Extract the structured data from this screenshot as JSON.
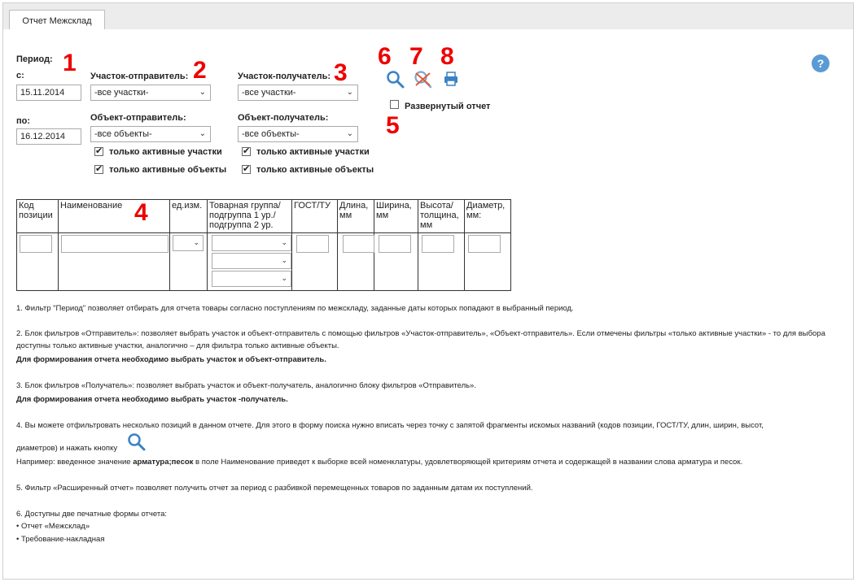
{
  "tab": "Отчет Межсклад",
  "period": {
    "label": "Период:",
    "from_label": "с:",
    "from_value": "15.11.2014",
    "to_label": "по:",
    "to_value": "16.12.2014"
  },
  "sender": {
    "section_label": "Участок-отправитель:",
    "section_value": "-все участки-",
    "object_label": "Объект-отправитель:",
    "object_value": "-все объекты-",
    "active_sections": "только активные участки",
    "active_objects": "только активные объекты"
  },
  "receiver": {
    "section_label": "Участок-получатель:",
    "section_value": "-все участки-",
    "object_label": "Объект-получатель:",
    "object_value": "-все объекты-",
    "active_sections": "только активные участки",
    "active_objects": "только активные объекты"
  },
  "expanded_report": "Развернутый отчет",
  "help": "?",
  "markers": [
    "1",
    "2",
    "3",
    "4",
    "5",
    "6",
    "7",
    "8"
  ],
  "table_headers": [
    "Код позиции",
    "Наименование",
    "ед.изм.",
    "Товарная группа/ подгруппа 1 ур./ подгруппа 2 ур.",
    "ГОСТ/ТУ",
    "Длина, мм",
    "Ширина, мм",
    "Высота/ толщина, мм",
    "Диаметр, мм:"
  ],
  "info": {
    "p1": "1. Фильтр \"Период\" позволяет отбирать для отчета товары согласно поступлениям по межскладу, заданные даты которых попадают в выбранный период.",
    "p2a": "2. Блок фильтров «Отправитель»: позволяет выбрать участок и объект-отправитель с помощью фильтров «Участок-отправитель», «Объект-отправитель». Если отмечены фильтры «только активные участки» - то для выбора доступны только активные участки, аналогично – для фильтра только активные объекты.",
    "p2b": "Для формирования отчета необходимо выбрать участок и объект-отправитель.",
    "p3a": "3. Блок фильтров «Получатель»: позволяет выбрать участок и объект-получатель, аналогично блоку фильтров «Отправитель».",
    "p3b": "Для формирования отчета необходимо выбрать участок -получатель.",
    "p4a": "4. Вы можете отфильтровать несколько позиций в данном отчете. Для этого в форму поиска нужно вписать через точку с запятой фрагменты искомых названий (кодов позиции, ГОСТ/ТУ, длин, ширин, высот,",
    "p4b": "диаметров) и нажать кнопку",
    "p4c_pre": "Например: введенное значение ",
    "p4c_bold": "арматура;песок",
    "p4c_post": " в поле Наименование приведет к выборке всей номенклатуры, удовлетворяющей критериям отчета и содержащей в названии слова арматура и песок.",
    "p5": "5. Фильтр «Расширенный отчет» позволяет получить отчет за период с разбивкой перемещенных товаров по заданным датам их поступлений.",
    "p6": "6. Доступны две печатные формы отчета:",
    "b1": "Отчет «Межсклад»",
    "b2": "Требование-накладная"
  }
}
